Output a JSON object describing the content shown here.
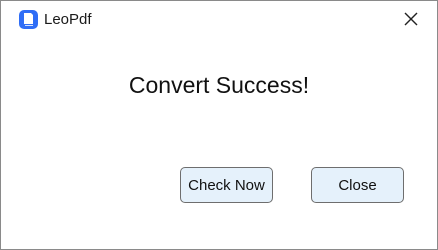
{
  "window": {
    "title": "LeoPdf",
    "icons": {
      "app": "leopdf-logo-icon",
      "close": "close-icon"
    }
  },
  "dialog": {
    "message": "Convert Success!",
    "buttons": {
      "check_now": "Check Now",
      "close": "Close"
    }
  },
  "colors": {
    "logo": "#2f6df6",
    "button_bg": "#e5f1fb",
    "button_border": "#6e6e6e"
  }
}
